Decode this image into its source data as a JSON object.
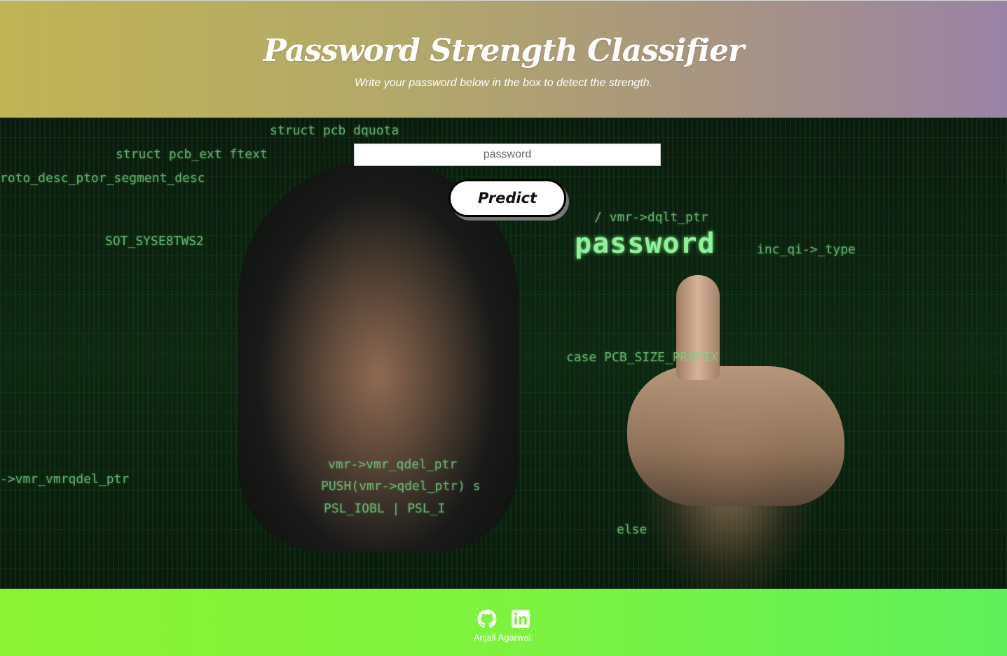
{
  "header": {
    "title": "Password Strength Classifier",
    "subtitle": "Write your password below in the box to detect the strength."
  },
  "form": {
    "password_placeholder": "password",
    "password_value": "",
    "predict_label": "Predict"
  },
  "hero": {
    "background_word": "password",
    "code_lines": [
      "struct pcb dquota",
      "struct pcb_ext ftext",
      "roto_desc_ptor_segment_desc",
      "SOT_SYSE8TWS2",
      "/ vmr->dqlt_ptr",
      "inc_qi->_type",
      "case PCB_SIZE_PREFIX",
      "PUSH(vmr->qdel_ptr) s",
      "PSL_IOBL | PSL_I",
      "vmr->vmr_qdel_ptr",
      "->vmr_vmrqdel_ptr",
      "else"
    ]
  },
  "footer": {
    "author": "Anjali Agarwal.",
    "icons": [
      "github-icon",
      "linkedin-icon"
    ]
  },
  "colors": {
    "header_gradient_start": "#c1b455",
    "header_gradient_end": "#9a83a6",
    "footer_gradient_start": "#8bf233",
    "footer_gradient_end": "#5ef05a",
    "matrix_green": "#7fd38a"
  }
}
